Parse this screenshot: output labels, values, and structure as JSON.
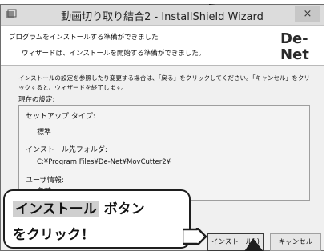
{
  "window": {
    "title": "動画切り取り結合2 - InstallShield Wizard",
    "close_glyph": "×"
  },
  "header": {
    "title": "プログラムをインストールする準備ができました",
    "subtitle": "ウィザードは、インストールを開始する準備ができました。",
    "logo_text_top": "De-",
    "logo_text_bottom": "Net"
  },
  "body": {
    "instructions": "インストールの設定を参照したり変更する場合は、「戻る」をクリックしてください。「キャンセル」をクリックすると、ウィザードを終了します。",
    "current_settings_label": "現在の設定:"
  },
  "settings": {
    "setup_type_label": "セットアップ タイプ:",
    "setup_type_value": "標準",
    "install_folder_label": "インストール先フォルダ:",
    "install_folder_value": "C:¥Program Files¥De-Net¥MovCutter2¥",
    "user_info_label": "ユーザ情報:",
    "name_label": "名前:"
  },
  "buttons": {
    "install_label": "インストール(I)",
    "cancel_label": "キャンセル"
  },
  "callout": {
    "highlight": "インストール",
    "line1_rest": " ボタン",
    "line2": "をクリック！"
  }
}
